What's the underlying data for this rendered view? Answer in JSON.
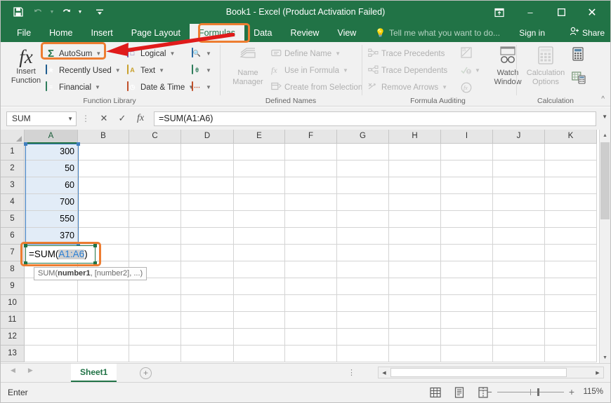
{
  "window": {
    "title": "Book1 - Excel (Product Activation Failed)",
    "quick_access": [
      {
        "name": "save-icon",
        "label": "Save"
      },
      {
        "name": "undo-icon",
        "label": "Undo"
      },
      {
        "name": "redo-icon",
        "label": "Redo"
      },
      {
        "name": "customize-qat-icon",
        "label": "Customize Quick Access Toolbar"
      }
    ],
    "controls": {
      "ribbon_display": "⤒",
      "minimize": "–",
      "maximize": "☐",
      "close": "✕"
    }
  },
  "tabs": [
    {
      "label": "File",
      "active": false
    },
    {
      "label": "Home",
      "active": false
    },
    {
      "label": "Insert",
      "active": false
    },
    {
      "label": "Page Layout",
      "active": false
    },
    {
      "label": "Formulas",
      "active": true
    },
    {
      "label": "Data",
      "active": false
    },
    {
      "label": "Review",
      "active": false
    },
    {
      "label": "View",
      "active": false
    }
  ],
  "tellme": {
    "icon": "lightbulb-icon",
    "placeholder": "Tell me what you want to do..."
  },
  "account": {
    "sign_in": "Sign in",
    "share": "Share",
    "share_icon": "person-share-icon"
  },
  "ribbon": {
    "groups": [
      {
        "name": "function-library",
        "label": "Function Library"
      },
      {
        "name": "defined-names",
        "label": "Defined Names"
      },
      {
        "name": "formula-auditing",
        "label": "Formula Auditing"
      },
      {
        "name": "calculation",
        "label": "Calculation"
      }
    ],
    "insert_function": {
      "line1": "Insert",
      "line2": "Function",
      "icon": "fx-icon"
    },
    "function_library": [
      {
        "label": "AutoSum",
        "icon": "sigma-icon",
        "caret": true,
        "highlighted": true
      },
      {
        "label": "Recently Used",
        "icon": "recently-used-icon",
        "caret": true
      },
      {
        "label": "Financial",
        "icon": "financial-icon",
        "caret": true
      },
      {
        "label": "Logical",
        "icon": "logical-icon",
        "caret": true
      },
      {
        "label": "Text",
        "icon": "text-icon",
        "caret": true
      },
      {
        "label": "Date & Time",
        "icon": "date-time-icon",
        "caret": true
      },
      {
        "label": "",
        "icon": "lookup-reference-icon",
        "caret": true
      },
      {
        "label": "",
        "icon": "math-trig-icon",
        "caret": true
      },
      {
        "label": "",
        "icon": "more-functions-icon",
        "caret": true
      }
    ],
    "name_manager": {
      "line1": "Name",
      "line2": "Manager",
      "icon": "name-manager-icon"
    },
    "defined_names": [
      {
        "label": "Define Name",
        "icon": "define-name-icon",
        "caret": true,
        "disabled": true
      },
      {
        "label": "Use in Formula",
        "icon": "use-in-formula-icon",
        "caret": true,
        "disabled": true
      },
      {
        "label": "Create from Selection",
        "icon": "create-from-selection-icon",
        "caret": false,
        "disabled": true
      }
    ],
    "formula_auditing": [
      {
        "label": "Trace Precedents",
        "icon": "trace-precedents-icon",
        "disabled": true
      },
      {
        "label": "Trace Dependents",
        "icon": "trace-dependents-icon",
        "disabled": true
      },
      {
        "label": "Remove Arrows",
        "icon": "remove-arrows-icon",
        "caret": true,
        "disabled": true
      }
    ],
    "auditing_extras": [
      {
        "name": "show-formulas-icon",
        "disabled": true
      },
      {
        "name": "error-checking-icon",
        "disabled": true
      },
      {
        "name": "evaluate-formula-icon",
        "disabled": true
      }
    ],
    "watch_window": {
      "line1": "Watch",
      "line2": "Window",
      "icon": "watch-window-icon"
    },
    "calculation_options": {
      "line1": "Calculation",
      "line2": "Options",
      "icon": "calculation-options-icon",
      "caret": true
    },
    "calculation_extras": [
      {
        "name": "calculate-now-icon"
      },
      {
        "name": "calculate-sheet-icon"
      }
    ],
    "collapse_icon": "chevron-up-icon"
  },
  "formula_bar": {
    "name_box_value": "SUM",
    "cancel_icon": "cancel-x-icon",
    "enter_icon": "enter-check-icon",
    "insert_function_icon": "fx-icon",
    "formula_value": "=SUM(A1:A6)",
    "expand_icon": "chevron-down-icon"
  },
  "grid": {
    "columns": [
      "A",
      "B",
      "C",
      "D",
      "E",
      "F",
      "G",
      "H",
      "I",
      "J",
      "K"
    ],
    "selected_column": "A",
    "rows": [
      1,
      2,
      3,
      4,
      5,
      6,
      7,
      8,
      9,
      10,
      11,
      12,
      13
    ],
    "column_a_values": [
      "300",
      "50",
      "60",
      "700",
      "550",
      "370"
    ],
    "selection_range": "A1:A6",
    "active_cell": "A7",
    "edit_text": {
      "prefix": "=SUM(",
      "reference": "A1:A6",
      "suffix": ")"
    },
    "tooltip": {
      "prefix": "SUM(",
      "bold": "number1",
      "suffix": ", [number2], ...)"
    }
  },
  "sheet_tabs": {
    "prev_icon": "prev-sheet-icon",
    "next_icon": "next-sheet-icon",
    "sheets": [
      {
        "label": "Sheet1",
        "active": true
      }
    ],
    "add_sheet_icon": "add-sheet-icon",
    "add_sheet_label": "+"
  },
  "status_bar": {
    "mode": "Enter",
    "views": [
      {
        "name": "normal-view-icon",
        "label": "Normal"
      },
      {
        "name": "page-layout-view-icon",
        "label": "Page Layout"
      },
      {
        "name": "page-break-preview-icon",
        "label": "Page Break Preview"
      }
    ],
    "zoom_out_label": "−",
    "zoom_in_label": "+",
    "zoom_level": "115%"
  },
  "annotations": {
    "highlight_autosum": "orange-rect-autosum",
    "highlight_formulas_tab": "orange-rect-formulas-tab",
    "highlight_edit_cell": "orange-rect-edit-cell",
    "arrow": "red-arrow-to-autosum",
    "arrow_color": "#e01b1b",
    "highlight_color": "#ed7d31"
  }
}
